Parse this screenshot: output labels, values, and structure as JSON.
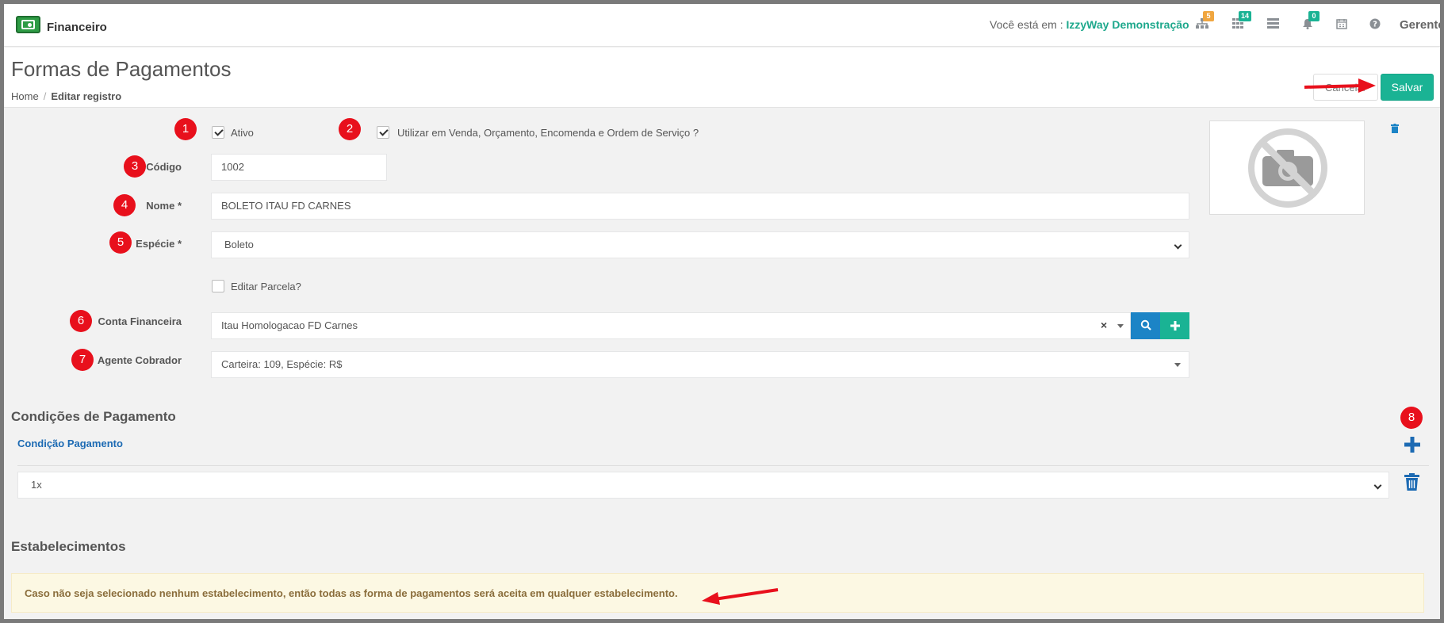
{
  "header": {
    "app_name": "Financeiro",
    "you_are_label": "Você está em : ",
    "company": "IzzyWay Demonstração",
    "user": "Gerente",
    "badges": {
      "network": "5",
      "grid": "14",
      "bell": "0"
    }
  },
  "page": {
    "title": "Formas de Pagamentos",
    "breadcrumb_home": "Home",
    "breadcrumb_sep": "/",
    "breadcrumb_current": "Editar registro",
    "cancel_label": "Cancelar",
    "save_label": "Salvar"
  },
  "form": {
    "ativo_label": "Ativo",
    "ativo_checked": true,
    "utilizar_label": "Utilizar em Venda, Orçamento, Encomenda e Ordem de Serviço ?",
    "utilizar_checked": true,
    "codigo_label": "Código",
    "codigo_value": "1002",
    "nome_label": "Nome",
    "required_mark": "*",
    "nome_value": "BOLETO ITAU FD CARNES",
    "especie_label": "Espécie",
    "especie_value": "Boleto",
    "editar_parcela_label": "Editar Parcela?",
    "editar_parcela_checked": false,
    "conta_label": "Conta Financeira",
    "conta_value": "Itau Homologacao FD Carnes",
    "agente_label": "Agente Cobrador",
    "agente_value": "Carteira: 109, Espécie: R$"
  },
  "conditions": {
    "title": "Condições de Pagamento",
    "column_label": "Condição Pagamento",
    "rows": [
      "1x"
    ]
  },
  "establishments": {
    "title": "Estabelecimentos",
    "alert": "Caso não seja selecionado nenhum estabelecimento, então todas as forma de pagamentos será aceita em qualquer estabelecimento."
  },
  "markers": [
    "1",
    "2",
    "3",
    "4",
    "5",
    "6",
    "7",
    "8"
  ],
  "colors": {
    "accent": "#1ab394",
    "primary": "#1c84c6",
    "marker": "#e8101c",
    "alert_bg": "#fcf8e3"
  }
}
